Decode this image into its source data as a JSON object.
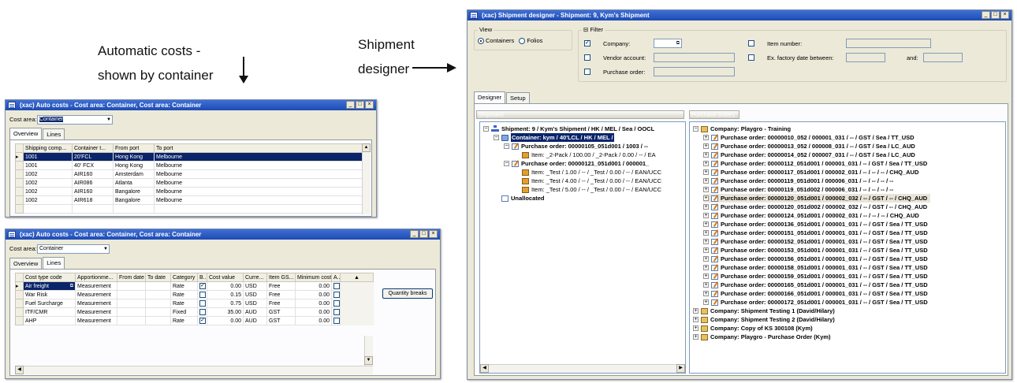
{
  "annotations": {
    "auto_costs_line1": "Automatic costs -",
    "auto_costs_line2": "shown by container",
    "designer_line1": "Shipment",
    "designer_line2": "designer"
  },
  "auto_costs_1": {
    "title": "(xac) Auto costs - Cost area: Container, Cost area: Container",
    "cost_area_label": "Cost area:",
    "cost_area_value": "Container",
    "tabs": [
      "Overview",
      "Lines"
    ],
    "columns": [
      "Shipping comp...",
      "Container t...",
      "From port",
      "To port"
    ],
    "rows": [
      [
        "1001",
        "20'FCL",
        "Hong Kong",
        "Melbourne"
      ],
      [
        "1001",
        "40' FCX",
        "Hong Kong",
        "Melbourne"
      ],
      [
        "1002",
        "AIR160",
        "Amsterdam",
        "Melbourne"
      ],
      [
        "1002",
        "AIR086",
        "Atlanta",
        "Melbourne"
      ],
      [
        "1002",
        "AIR160",
        "Bangalore",
        "Melbourne"
      ],
      [
        "1002",
        "AIR618",
        "Bangalore",
        "Melbourne"
      ]
    ]
  },
  "auto_costs_2": {
    "title": "(xac) Auto costs - Cost area: Container, Cost area: Container",
    "cost_area_label": "Cost area:",
    "cost_area_value": "Container",
    "tabs": [
      "Overview",
      "Lines"
    ],
    "columns": [
      "Cost type code",
      "Apportionme...",
      "From date",
      "To date",
      "Category",
      "B...",
      "Cost value",
      "Curre...",
      "Item GS...",
      "Minimum cost",
      "A..."
    ],
    "rows": [
      {
        "code": "Air freight",
        "apportion": "Measurement",
        "from": "",
        "to": "",
        "category": "Rate",
        "b": true,
        "value": "0.00",
        "currency": "USD",
        "item_gst": "Free",
        "min_cost": "0.00",
        "a": false
      },
      {
        "code": "War Risk",
        "apportion": "Measurement",
        "from": "",
        "to": "",
        "category": "Rate",
        "b": false,
        "value": "0.15",
        "currency": "USD",
        "item_gst": "Free",
        "min_cost": "0.00",
        "a": false
      },
      {
        "code": "Fuel Surcharge",
        "apportion": "Measurement",
        "from": "",
        "to": "",
        "category": "Rate",
        "b": false,
        "value": "0.75",
        "currency": "USD",
        "item_gst": "Free",
        "min_cost": "0.00",
        "a": false
      },
      {
        "code": "ITF/CMR",
        "apportion": "Measurement",
        "from": "",
        "to": "",
        "category": "Fixed",
        "b": false,
        "value": "35.00",
        "currency": "AUD",
        "item_gst": "GST",
        "min_cost": "0.00",
        "a": false
      },
      {
        "code": "AHP",
        "apportion": "Measurement",
        "from": "",
        "to": "",
        "category": "Rate",
        "b": true,
        "value": "0.00",
        "currency": "AUD",
        "item_gst": "GST",
        "min_cost": "0.00",
        "a": false
      }
    ],
    "quantity_breaks_label": "Quantity breaks"
  },
  "designer": {
    "title": "(xac) Shipment designer - Shipment: 9, Kym's Shipment",
    "view_group": "View",
    "view_containers": "Containers",
    "view_folios": "Folios",
    "filter_group": "Filter",
    "company_label": "Company:",
    "vendor_label": "Vendor account:",
    "po_label": "Purchase order:",
    "item_number_label": "Item number:",
    "ex_factory_label": "Ex. factory date between:",
    "and_label": "and:",
    "tabs": [
      "Designer",
      "Setup"
    ],
    "shipment_header": "Shipment",
    "po_header": "Purchase orders",
    "shipment_tree": [
      "Shipment: 9 / Kym's Shipment / HK / MEL / Sea / OOCL",
      "Container: kym / 40'LCL / HK / MEL /",
      "Purchase order: 00000105_051d001 / 1003 / --",
      "Item: _2-Pack / 100.00 / _2-Pack / 0.00 / -- / EA",
      "Purchase order: 00000121_051d001 / 000001_",
      "Item: _Test / 1.00 / -- / _Test / 0.00 / -- / EAN/UCC",
      "Item: _Test / 4.00 / -- / _Test / 0.00 / -- / EAN/UCC",
      "Item: _Test / 5.00 / -- / _Test / 0.00 / -- / EAN/UCC",
      "Unallocated"
    ],
    "po_tree": [
      "Company: Playgro - Training",
      "Purchase order: 00000010_052 / 000001_031 / -- / GST / Sea / TT_USD",
      "Purchase order: 00000013_052 / 000008_031 / -- / GST / Sea / LC_AUD",
      "Purchase order: 00000014_052 / 000007_031 / -- / GST / Sea / LC_AUD",
      "Purchase order: 00000112_051d001 / 000001_031 / -- / GST / Sea / TT_USD",
      "Purchase order: 00000117_051d001 / 000002_031 / -- / -- / -- / CHQ_AUD",
      "Purchase order: 00000119_051d001 / 000006_031 / -- / -- / -- / --",
      "Purchase order: 00000119_051d002 / 000006_031 / -- / -- / -- / --",
      "Purchase order: 00000120_051d001 / 000002_032 / -- / GST / -- / CHQ_AUD",
      "Purchase order: 00000120_051d002 / 000002_032 / -- / GST / -- / CHQ_AUD",
      "Purchase order: 00000124_051d001 / 000002_031 / -- / -- / -- / CHQ_AUD",
      "Purchase order: 00000136_051d001 / 000001_031 / -- / GST / Sea / TT_USD",
      "Purchase order: 00000151_051d001 / 000001_031 / -- / GST / Sea / TT_USD",
      "Purchase order: 00000152_051d001 / 000001_031 / -- / GST / Sea / TT_USD",
      "Purchase order: 00000153_051d001 / 000001_031 / -- / GST / Sea / TT_USD",
      "Purchase order: 00000156_051d001 / 000001_031 / -- / GST / Sea / TT_USD",
      "Purchase order: 00000158_051d001 / 000001_031 / -- / GST / Sea / TT_USD",
      "Purchase order: 00000159_051d001 / 000001_031 / -- / GST / Sea / TT_USD",
      "Purchase order: 00000165_051d001 / 000001_031 / -- / GST / Sea / TT_USD",
      "Purchase order: 00000166_051d001 / 000001_031 / -- / GST / Sea / TT_USD",
      "Purchase order: 00000172_051d001 / 000001_031 / -- / GST / Sea / TT_USD",
      "Company: Shipment Testing 1 (David/Hilary)",
      "Company: Shipment Testing 2 (David/Hilary)",
      "Company: Copy of KS 300108 (Kym)",
      "Company: Playgro - Purchase Order (Kym)"
    ]
  },
  "window_buttons": {
    "min": "_",
    "max": "□",
    "close": "×"
  }
}
